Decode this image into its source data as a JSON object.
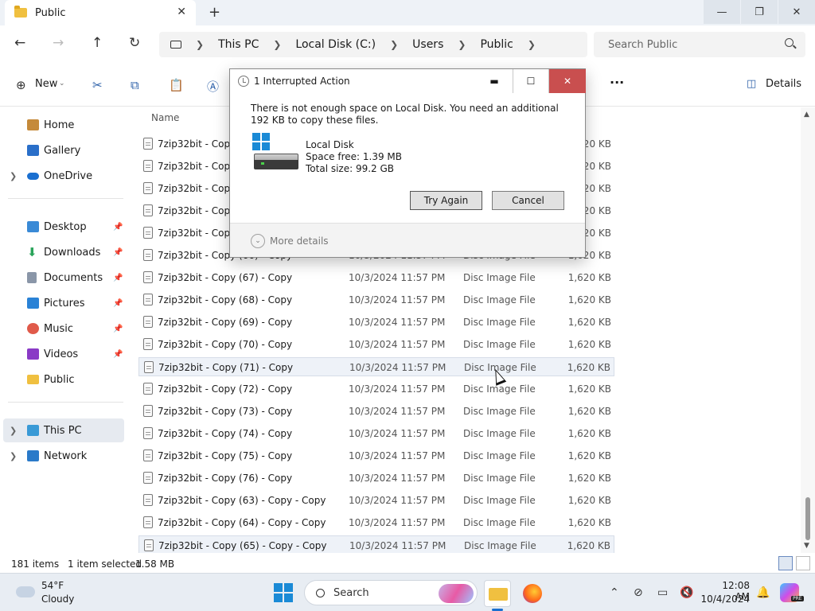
{
  "window": {
    "tab_title": "Public",
    "tab_close": "✕",
    "new_tab": "+",
    "minimize": "—",
    "restore": "❐",
    "close": "✕"
  },
  "address": {
    "crumbs": [
      "This PC",
      "Local Disk (C:)",
      "Users",
      "Public"
    ],
    "search_placeholder": "Search Public"
  },
  "command_bar": {
    "new_label": "New",
    "more": "···",
    "details_label": "Details"
  },
  "sidebar": {
    "quick": [
      {
        "label": "Home",
        "icon": "home-icon",
        "color": "#c58a3a"
      },
      {
        "label": "Gallery",
        "icon": "gallery-icon",
        "color": "#2a6fc9"
      },
      {
        "label": "OneDrive",
        "icon": "cloud-icon",
        "color": "#1a6fd0"
      }
    ],
    "pinned": [
      {
        "label": "Desktop",
        "icon": "desktop-icon",
        "color": "#3a8ad6"
      },
      {
        "label": "Downloads",
        "icon": "download-icon",
        "color": "#2aa45a"
      },
      {
        "label": "Documents",
        "icon": "documents-icon",
        "color": "#8a96a8"
      },
      {
        "label": "Pictures",
        "icon": "pictures-icon",
        "color": "#2a82d6"
      },
      {
        "label": "Music",
        "icon": "music-icon",
        "color": "#e05a4a"
      },
      {
        "label": "Videos",
        "icon": "videos-icon",
        "color": "#8a3ac6"
      },
      {
        "label": "Public",
        "icon": "folder-icon",
        "color": "#f0c040"
      }
    ],
    "devices": [
      {
        "label": "This PC",
        "icon": "pc-icon",
        "color": "#3a9ad6"
      },
      {
        "label": "Network",
        "icon": "network-icon",
        "color": "#2a7ac9"
      }
    ]
  },
  "file_list": {
    "columns": {
      "name": "Name"
    },
    "rows": [
      {
        "name": "7zip32bit - Copy (",
        "date": "",
        "type": "",
        "size": "1,620 KB"
      },
      {
        "name": "7zip32bit - Copy (",
        "date": "",
        "type": "",
        "size": "1,620 KB"
      },
      {
        "name": "7zip32bit - Copy (",
        "date": "",
        "type": "",
        "size": "1,620 KB"
      },
      {
        "name": "7zip32bit - Copy (",
        "date": "",
        "type": "",
        "size": "1,620 KB"
      },
      {
        "name": "7zip32bit - Copy (",
        "date": "",
        "type": "",
        "size": "1,620 KB"
      },
      {
        "name": "7zip32bit - Copy (66) - Copy",
        "date": "10/3/2024 11:57 PM",
        "type": "Disc Image File",
        "size": "1,620 KB"
      },
      {
        "name": "7zip32bit - Copy (67) - Copy",
        "date": "10/3/2024 11:57 PM",
        "type": "Disc Image File",
        "size": "1,620 KB"
      },
      {
        "name": "7zip32bit - Copy (68) - Copy",
        "date": "10/3/2024 11:57 PM",
        "type": "Disc Image File",
        "size": "1,620 KB"
      },
      {
        "name": "7zip32bit - Copy (69) - Copy",
        "date": "10/3/2024 11:57 PM",
        "type": "Disc Image File",
        "size": "1,620 KB"
      },
      {
        "name": "7zip32bit - Copy (70) - Copy",
        "date": "10/3/2024 11:57 PM",
        "type": "Disc Image File",
        "size": "1,620 KB"
      },
      {
        "name": "7zip32bit - Copy (71) - Copy",
        "date": "10/3/2024 11:57 PM",
        "type": "Disc Image File",
        "size": "1,620 KB",
        "hover": true
      },
      {
        "name": "7zip32bit - Copy (72) - Copy",
        "date": "10/3/2024 11:57 PM",
        "type": "Disc Image File",
        "size": "1,620 KB"
      },
      {
        "name": "7zip32bit - Copy (73) - Copy",
        "date": "10/3/2024 11:57 PM",
        "type": "Disc Image File",
        "size": "1,620 KB"
      },
      {
        "name": "7zip32bit - Copy (74) - Copy",
        "date": "10/3/2024 11:57 PM",
        "type": "Disc Image File",
        "size": "1,620 KB"
      },
      {
        "name": "7zip32bit - Copy (75) - Copy",
        "date": "10/3/2024 11:57 PM",
        "type": "Disc Image File",
        "size": "1,620 KB"
      },
      {
        "name": "7zip32bit - Copy (76) - Copy",
        "date": "10/3/2024 11:57 PM",
        "type": "Disc Image File",
        "size": "1,620 KB"
      },
      {
        "name": "7zip32bit - Copy (63) - Copy - Copy",
        "date": "10/3/2024 11:57 PM",
        "type": "Disc Image File",
        "size": "1,620 KB"
      },
      {
        "name": "7zip32bit - Copy (64) - Copy - Copy",
        "date": "10/3/2024 11:57 PM",
        "type": "Disc Image File",
        "size": "1,620 KB"
      },
      {
        "name": "7zip32bit - Copy (65) - Copy - Copy",
        "date": "10/3/2024 11:57 PM",
        "type": "Disc Image File",
        "size": "1,620 KB",
        "selected": true
      }
    ]
  },
  "status": {
    "item_count": "181 items",
    "selection": "1 item selected",
    "selection_size": "1.58 MB"
  },
  "dialog": {
    "title": "1 Interrupted Action",
    "message": "There is not enough space on Local Disk. You need an additional 192 KB to copy these files.",
    "drive_name": "Local Disk",
    "space_free": "Space free: 1.39 MB",
    "total_size": "Total size: 99.2 GB",
    "try_again": "Try Again",
    "cancel": "Cancel",
    "more_details": "More details",
    "min": "▬",
    "max": "☐",
    "close": "✕"
  },
  "taskbar": {
    "temperature": "54°F",
    "condition": "Cloudy",
    "search_label": "Search",
    "time": "12:08 AM",
    "date": "10/4/2024",
    "copilot_badge": "PRE"
  }
}
